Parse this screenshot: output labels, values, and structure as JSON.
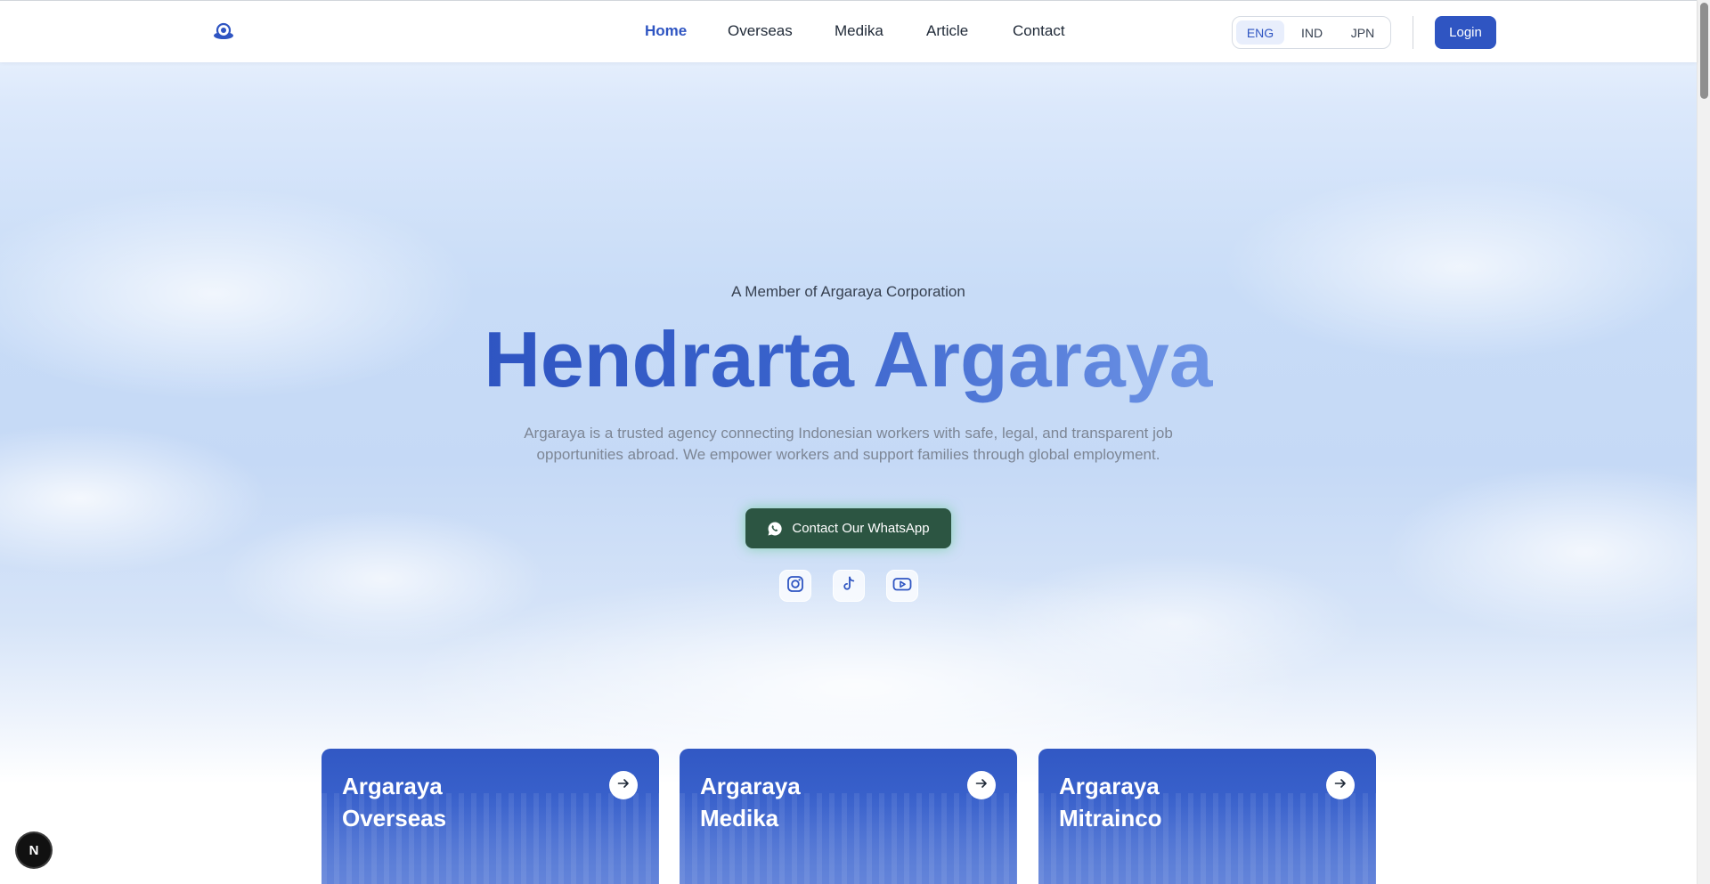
{
  "header": {
    "nav": [
      {
        "label": "Home",
        "active": true
      },
      {
        "label": "Overseas",
        "active": false
      },
      {
        "label": "Medika",
        "active": false
      },
      {
        "label": "Article",
        "active": false
      },
      {
        "label": "Contact",
        "active": false
      }
    ],
    "languages": [
      {
        "label": "ENG",
        "active": true
      },
      {
        "label": "IND",
        "active": false
      },
      {
        "label": "JPN",
        "active": false
      }
    ],
    "login_label": "Login"
  },
  "hero": {
    "eyebrow": "A Member of Argaraya Corporation",
    "title": "Hendrarta Argaraya",
    "description": "Argaraya is a trusted agency connecting Indonesian workers with safe, legal, and transparent job opportunities abroad. We empower workers and support families through global employment.",
    "whatsapp_label": "Contact Our WhatsApp",
    "social_icons": [
      "instagram-icon",
      "tiktok-icon",
      "youtube-icon"
    ]
  },
  "cards": [
    {
      "line1": "Argaraya",
      "line2": "Overseas"
    },
    {
      "line1": "Argaraya",
      "line2": "Medika"
    },
    {
      "line1": "Argaraya",
      "line2": "Mitrainco"
    }
  ],
  "badge": {
    "label": "N"
  },
  "colors": {
    "brand": "#2f55c2",
    "whatsapp": "#2c5542",
    "text_muted": "#7d8695"
  }
}
